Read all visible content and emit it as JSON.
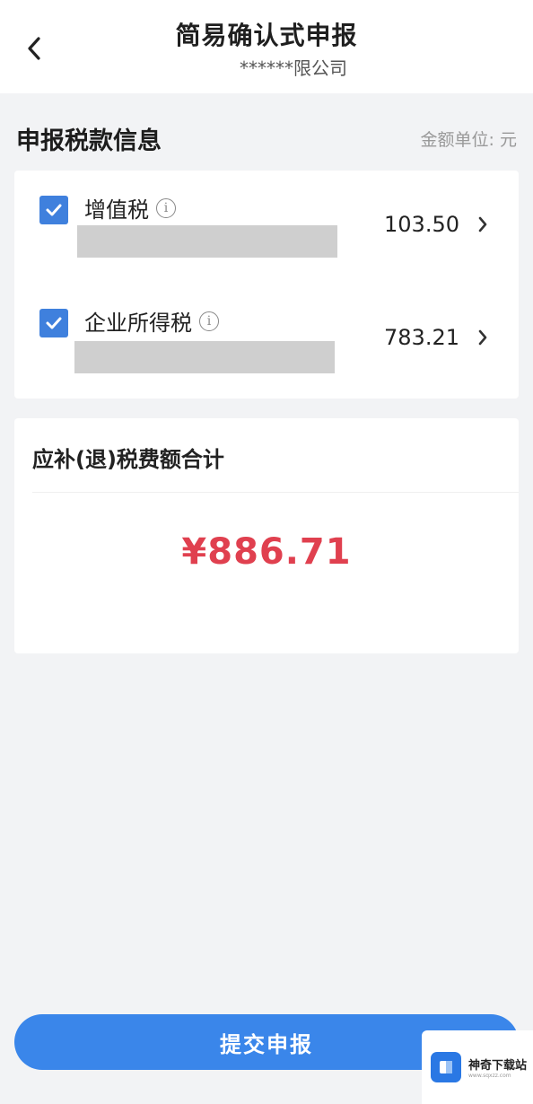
{
  "header": {
    "title": "简易确认式申报",
    "subtitle": "******限公司"
  },
  "section": {
    "title": "申报税款信息",
    "unit_label": "金额单位: 元"
  },
  "taxes": [
    {
      "name": "增值税",
      "amount": "103.50",
      "checked": true
    },
    {
      "name": "企业所得税",
      "amount": "783.21",
      "checked": true
    }
  ],
  "total": {
    "label": "应补(退)税费额合计",
    "amount": "¥886.71"
  },
  "submit_button": {
    "label": "提交申报"
  },
  "watermark": {
    "name": "神奇下载站",
    "url": "www.sqxzz.com"
  },
  "colors": {
    "accent": "#3a86ea",
    "checkbox": "#3f80dd",
    "total_amount": "#e0404f"
  }
}
